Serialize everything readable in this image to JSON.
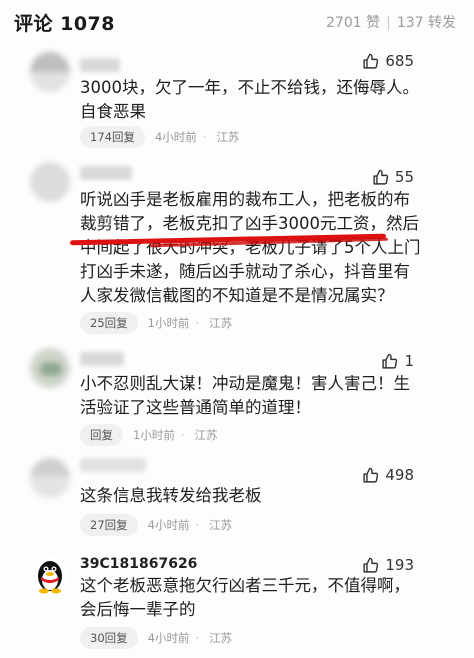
{
  "header": {
    "title": "评论 1078",
    "likes": "2701 赞",
    "shares": "137 转发"
  },
  "comments": [
    {
      "likes": "685",
      "text_lines": [
        "3000块，欠了一年，不止不给钱，还侮辱人。",
        "自食恶果"
      ],
      "reply_label": "174回复",
      "time": "4小时前",
      "location": "江苏"
    },
    {
      "likes": "55",
      "text_lines": [
        "听说凶手是老板雇用的裁布工人，把老板的布",
        "裁剪错了，老板克扣了凶手3000元工资，然后",
        "中间起了很大的冲突，老板儿子请了5个人上门",
        "打凶手未遂，随后凶手就动了杀心，抖音里有",
        "人家发微信截图的不知道是不是情况属实？"
      ],
      "reply_label": "25回复",
      "time": "1小时前",
      "location": "江苏"
    },
    {
      "likes": "1",
      "text_lines": [
        "小不忍则乱大谋！冲动是魔鬼！害人害己！生",
        "活验证了这些普通简单的道理！"
      ],
      "reply_label": "回复",
      "time": "1小时前",
      "location": "江苏"
    },
    {
      "likes": "498",
      "text_lines": [
        "这条信息我转发给我老板"
      ],
      "reply_label": "27回复",
      "time": "4小时前",
      "location": "江苏"
    },
    {
      "username": "39C181867626",
      "likes": "193",
      "text_lines": [
        "这个老板恶意拖欠行凶者三千元，不值得啊，",
        "会后悔一辈子的"
      ],
      "reply_label": "30回复",
      "time": "4小时前",
      "location": "江苏"
    }
  ],
  "colors": {
    "underline": "#dd1111",
    "meta_gray": "#999999",
    "pill_bg": "#f0f0f0"
  },
  "icons": [
    "thumbs-up-icon",
    "penguin-avatar-icon"
  ]
}
